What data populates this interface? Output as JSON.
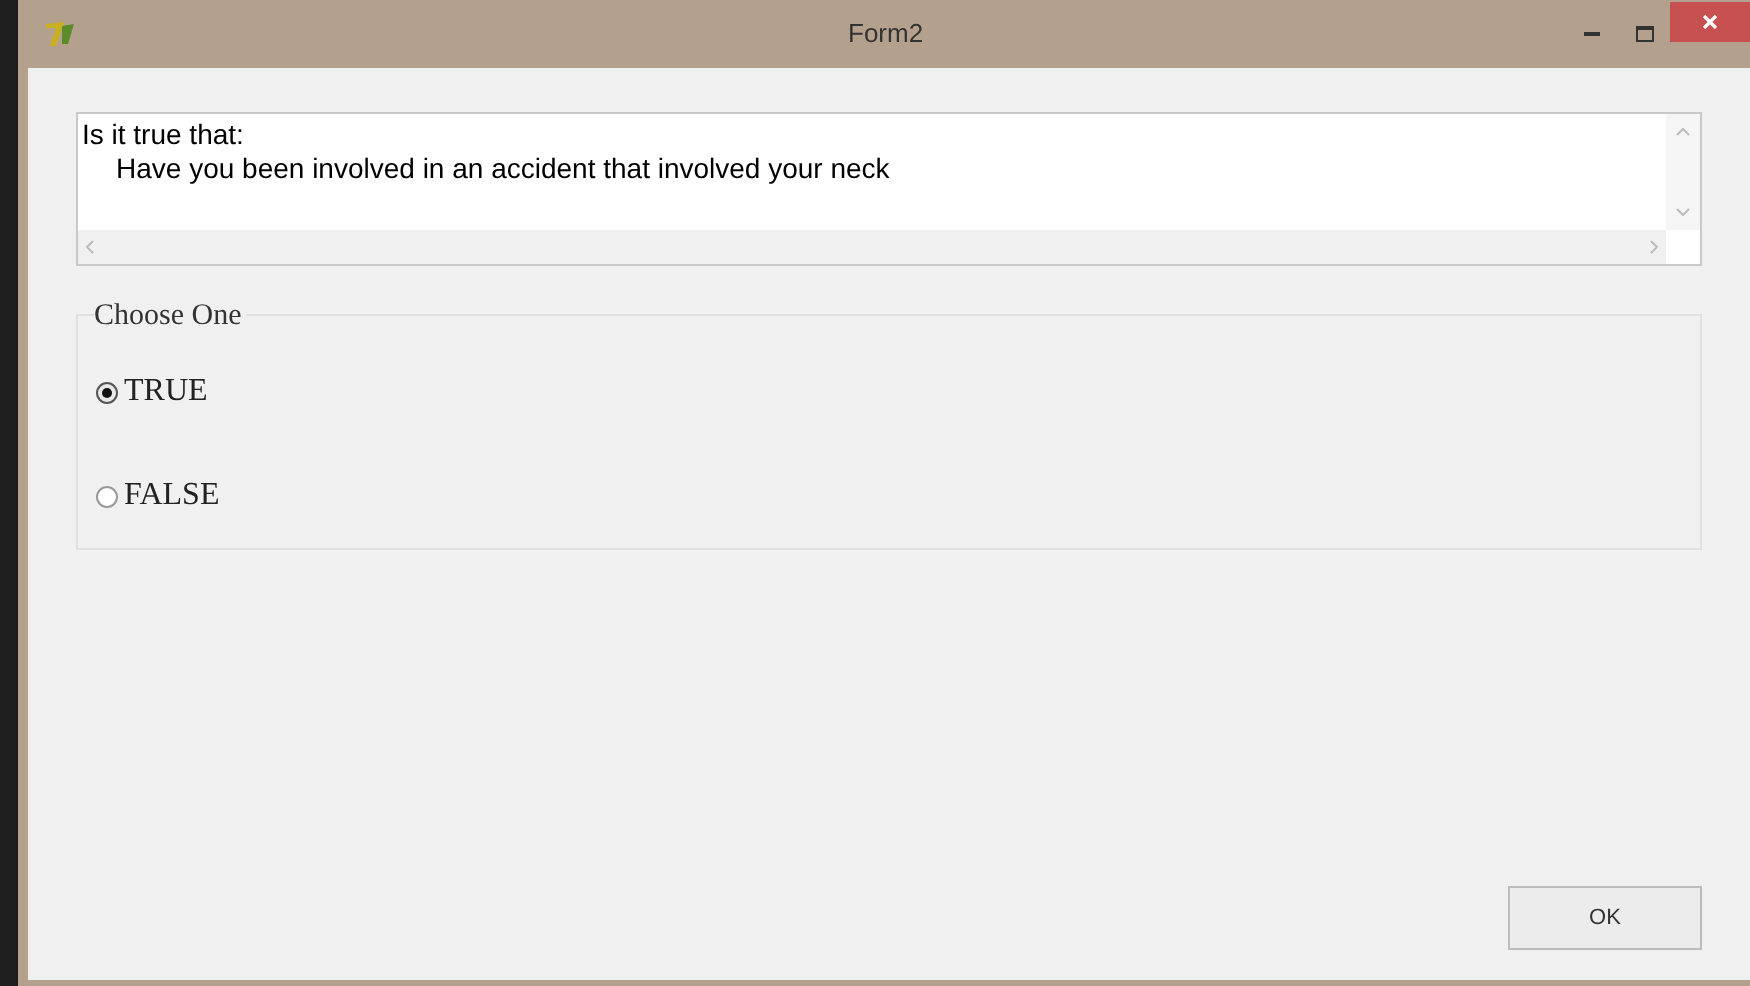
{
  "window": {
    "title": "Form2"
  },
  "question": {
    "lines": [
      "Is it true that:",
      "Have you been involved in an accident that involved your neck"
    ]
  },
  "group": {
    "title": "Choose One",
    "options": [
      {
        "label": "TRUE",
        "selected": true
      },
      {
        "label": "FALSE",
        "selected": false
      }
    ]
  },
  "buttons": [
    "OK"
  ]
}
